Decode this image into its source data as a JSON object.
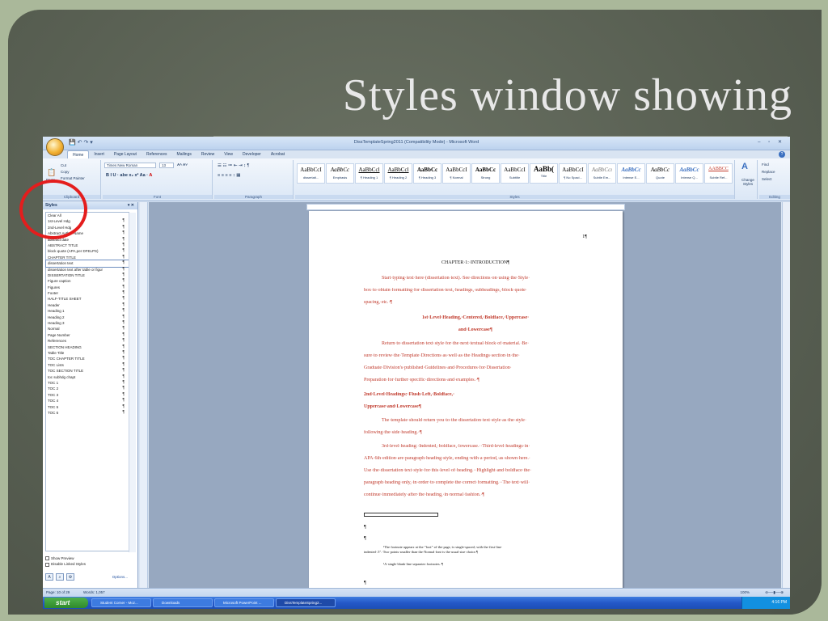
{
  "slide": {
    "title": "Styles window showing"
  },
  "window": {
    "title": "DissTemplateSpring2011 (Compatibility Mode) - Microsoft Word",
    "tabs": [
      "Home",
      "Insert",
      "Page Layout",
      "References",
      "Mailings",
      "Review",
      "View",
      "Developer",
      "Acrobat"
    ],
    "active_tab": "Home"
  },
  "ribbon": {
    "clipboard": {
      "paste": "Paste",
      "cut": "Cut",
      "copy": "Copy",
      "format_painter": "Format Painter",
      "label": "Clipboard"
    },
    "font": {
      "name": "Times New Roman",
      "size": "13",
      "label": "Font"
    },
    "paragraph": {
      "label": "Paragraph"
    },
    "styles": {
      "label": "Styles",
      "gallery": [
        {
          "preview": "AaBbCcI",
          "name": "dissertati..."
        },
        {
          "preview": "AaBbCc",
          "name": "Emphasis"
        },
        {
          "preview": "AaBbCcl",
          "name": "¶ Heading 1"
        },
        {
          "preview": "AaBbCcl",
          "name": "¶ Heading 2"
        },
        {
          "preview": "AaBbCc",
          "name": "¶ Heading 3"
        },
        {
          "preview": "AaBbCcI",
          "name": "¶ Normal"
        },
        {
          "preview": "AaBbCc",
          "name": "Strong"
        },
        {
          "preview": "AaBbCcI",
          "name": "Subtitle"
        },
        {
          "preview": "AaBb(",
          "name": "Title"
        },
        {
          "preview": "AaBbCcI",
          "name": "¶ No Spaci..."
        },
        {
          "preview": "AaBbCcı",
          "name": "Subtle Em..."
        },
        {
          "preview": "AaBbCc",
          "name": "Intense E..."
        },
        {
          "preview": "AaBbCc",
          "name": "Quote"
        },
        {
          "preview": "AaBbCc",
          "name": "Intense Q..."
        },
        {
          "preview": "AABBCC",
          "name": "Subtle Ref..."
        }
      ],
      "change_styles": "Change Styles"
    },
    "editing": {
      "find": "Find",
      "replace": "Replace",
      "select": "Select",
      "label": "Editing"
    }
  },
  "styles_pane": {
    "title": "Styles",
    "items": [
      "Clear All",
      "1st-Level Hdg",
      "2nd-Level Hdg",
      "Abstract Author Name",
      "abstract date",
      "ABSTRACT TITLE",
      "block quote (APA,per DFELPS)",
      "CHAPTER TITLE",
      "dissertation text",
      "dissertation text after table or figur",
      "DISSERTATION TITLE",
      "Figure caption",
      "Figures",
      "Footer",
      "HALF-TITLE SHEET",
      "Header",
      "Heading 1",
      "Heading 2",
      "Heading 3",
      "Normal",
      "Page Number",
      "References",
      "SECTION HEADING",
      "Table Title",
      "TOC CHAPTER TITLE",
      "TOC Lists",
      "TOC SECTION TITLE",
      "toc subhdg chapt",
      "TOC 1",
      "TOC 2",
      "TOC 3",
      "TOC 4",
      "TOC 5",
      "TOC 6"
    ],
    "selected": "dissertation text",
    "show_preview": "Show Preview",
    "disable_linked": "Disable Linked Styles",
    "options": "Options..."
  },
  "document": {
    "page_number": "1¶",
    "lines": [
      {
        "text": "CHAPTER·1:·INTRODUCTION¶",
        "style": "center blk"
      },
      {
        "text": "Start·typing·text·here·(dissertation·text).·See·directions·on·using·the·Style·",
        "style": "indent"
      },
      {
        "text": "box·to·obtain·formatting·for·dissertation·text,·headings,·subheadings,·block·quote·",
        "style": ""
      },
      {
        "text": "spacing,·etc.·¶",
        "style": ""
      },
      {
        "text": "1st·Level·Heading,·Centered,·Boldface,·Uppercase·",
        "style": "center bold"
      },
      {
        "text": "and·Lowercase¶",
        "style": "center bold"
      },
      {
        "text": "Return·to·dissertation·text·style·for·the·next·textual·block·of·material.·Be·",
        "style": "indent"
      },
      {
        "text": "sure·to·review·the·Template·Directions·as·well·as·the·Headings·section·in·the·",
        "style": ""
      },
      {
        "text": "Graduate·Division's·published·Guidelines·and·Procedures·for·Dissertation·",
        "style": ""
      },
      {
        "text": "Preparation·for·further·specific·directions·and·examples.·¶",
        "style": ""
      },
      {
        "text": "2nd·Level·Headings:·Flush·Left,·Boldface,·",
        "style": "bold"
      },
      {
        "text": "Uppercase·and·Lowercase¶",
        "style": "bold"
      },
      {
        "text": "The·template·should·return·you·to·the·dissertation·text·style·as·the·style·",
        "style": "indent"
      },
      {
        "text": "following·the·side·heading.·¶",
        "style": ""
      },
      {
        "text": "3rd-level·heading:·Indented,·boldface,·lowercase.··Third-level·headings·in·",
        "style": "indent"
      },
      {
        "text": "APA·6th·edition·are·paragraph·heading·style,·ending·with·a·period,·as·shown·here.·",
        "style": ""
      },
      {
        "text": "Use·the·dissertation·text·style·for·this·level·of·heading.··Highlight·and·boldface·the·",
        "style": ""
      },
      {
        "text": "paragraph·heading·only,·in·order·to·complete·the·correct·formatting.··The·text·will·",
        "style": ""
      },
      {
        "text": "continue·immediately·after·the·heading,·in·normal·fashion.·¶",
        "style": ""
      }
    ],
    "footnote_1": "¹The·footnote·appears·at·the·\"foot\"·of·the·page,·is·single-spaced,·with·the·first·line·",
    "footnote_2": "indented·.5\".·Two·points·smaller·than·the·Normal·font·is·the·usual·size·choice.¶",
    "footnote_3": "¹A·single·blank·line·separates·footnotes.·¶",
    "pilcrow": "¶"
  },
  "status": {
    "page": "Page: 10 of 29",
    "words": "Words: 1,057",
    "zoom": "100%"
  },
  "taskbar": {
    "start": "start",
    "tasks": [
      "Student Corner - Moz...",
      "Downloads",
      "Microsoft PowerPoint ...",
      "DissTemplateSpring2..."
    ],
    "clock": "4:16 PM"
  },
  "colors": {
    "annotation_circle": "#e41d1d",
    "doc_text": "#c0392b",
    "ribbon_blue": "#1f3a60"
  }
}
